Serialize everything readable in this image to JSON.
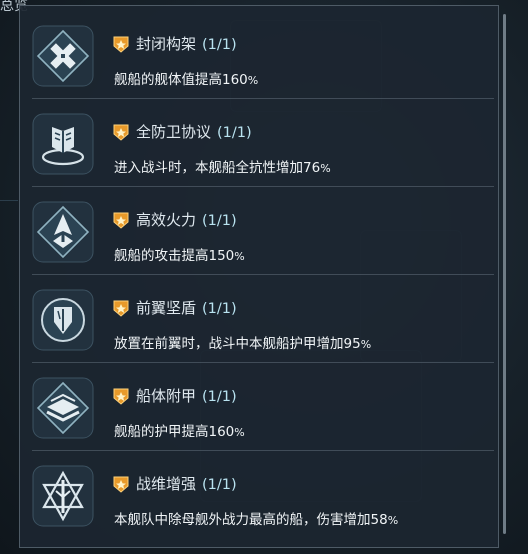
{
  "background": {
    "title": "总览"
  },
  "skills": [
    {
      "icon": "closed-frame-icon",
      "name": "封闭构架",
      "count": "(1/1)",
      "desc": "舰船的舰体值提高160",
      "unit": "%"
    },
    {
      "icon": "defense-shield-book-icon",
      "name": "全防卫协议",
      "count": "(1/1)",
      "desc": "进入战斗时，本舰船全抗性增加76",
      "unit": "%"
    },
    {
      "icon": "firepower-arrow-icon",
      "name": "高效火力",
      "count": "(1/1)",
      "desc": "舰船的攻击提高150",
      "unit": "%"
    },
    {
      "icon": "front-wing-shield-icon",
      "name": "前翼坚盾",
      "count": "(1/1)",
      "desc": "放置在前翼时，战斗中本舰船护甲增加95",
      "unit": "%"
    },
    {
      "icon": "hull-armor-layers-icon",
      "name": "船体附甲",
      "count": "(1/1)",
      "desc": "舰船的护甲提高160",
      "unit": "%"
    },
    {
      "icon": "tactical-boost-star-icon",
      "name": "战维增强",
      "count": "(1/1)",
      "desc": "本舰队中除母舰外战力最高的船，伤害增加58",
      "unit": "%"
    }
  ],
  "colors": {
    "accent": "#e89a2a",
    "icon_bg": "#2f4050",
    "icon_glyph": "#d8e4ea"
  }
}
